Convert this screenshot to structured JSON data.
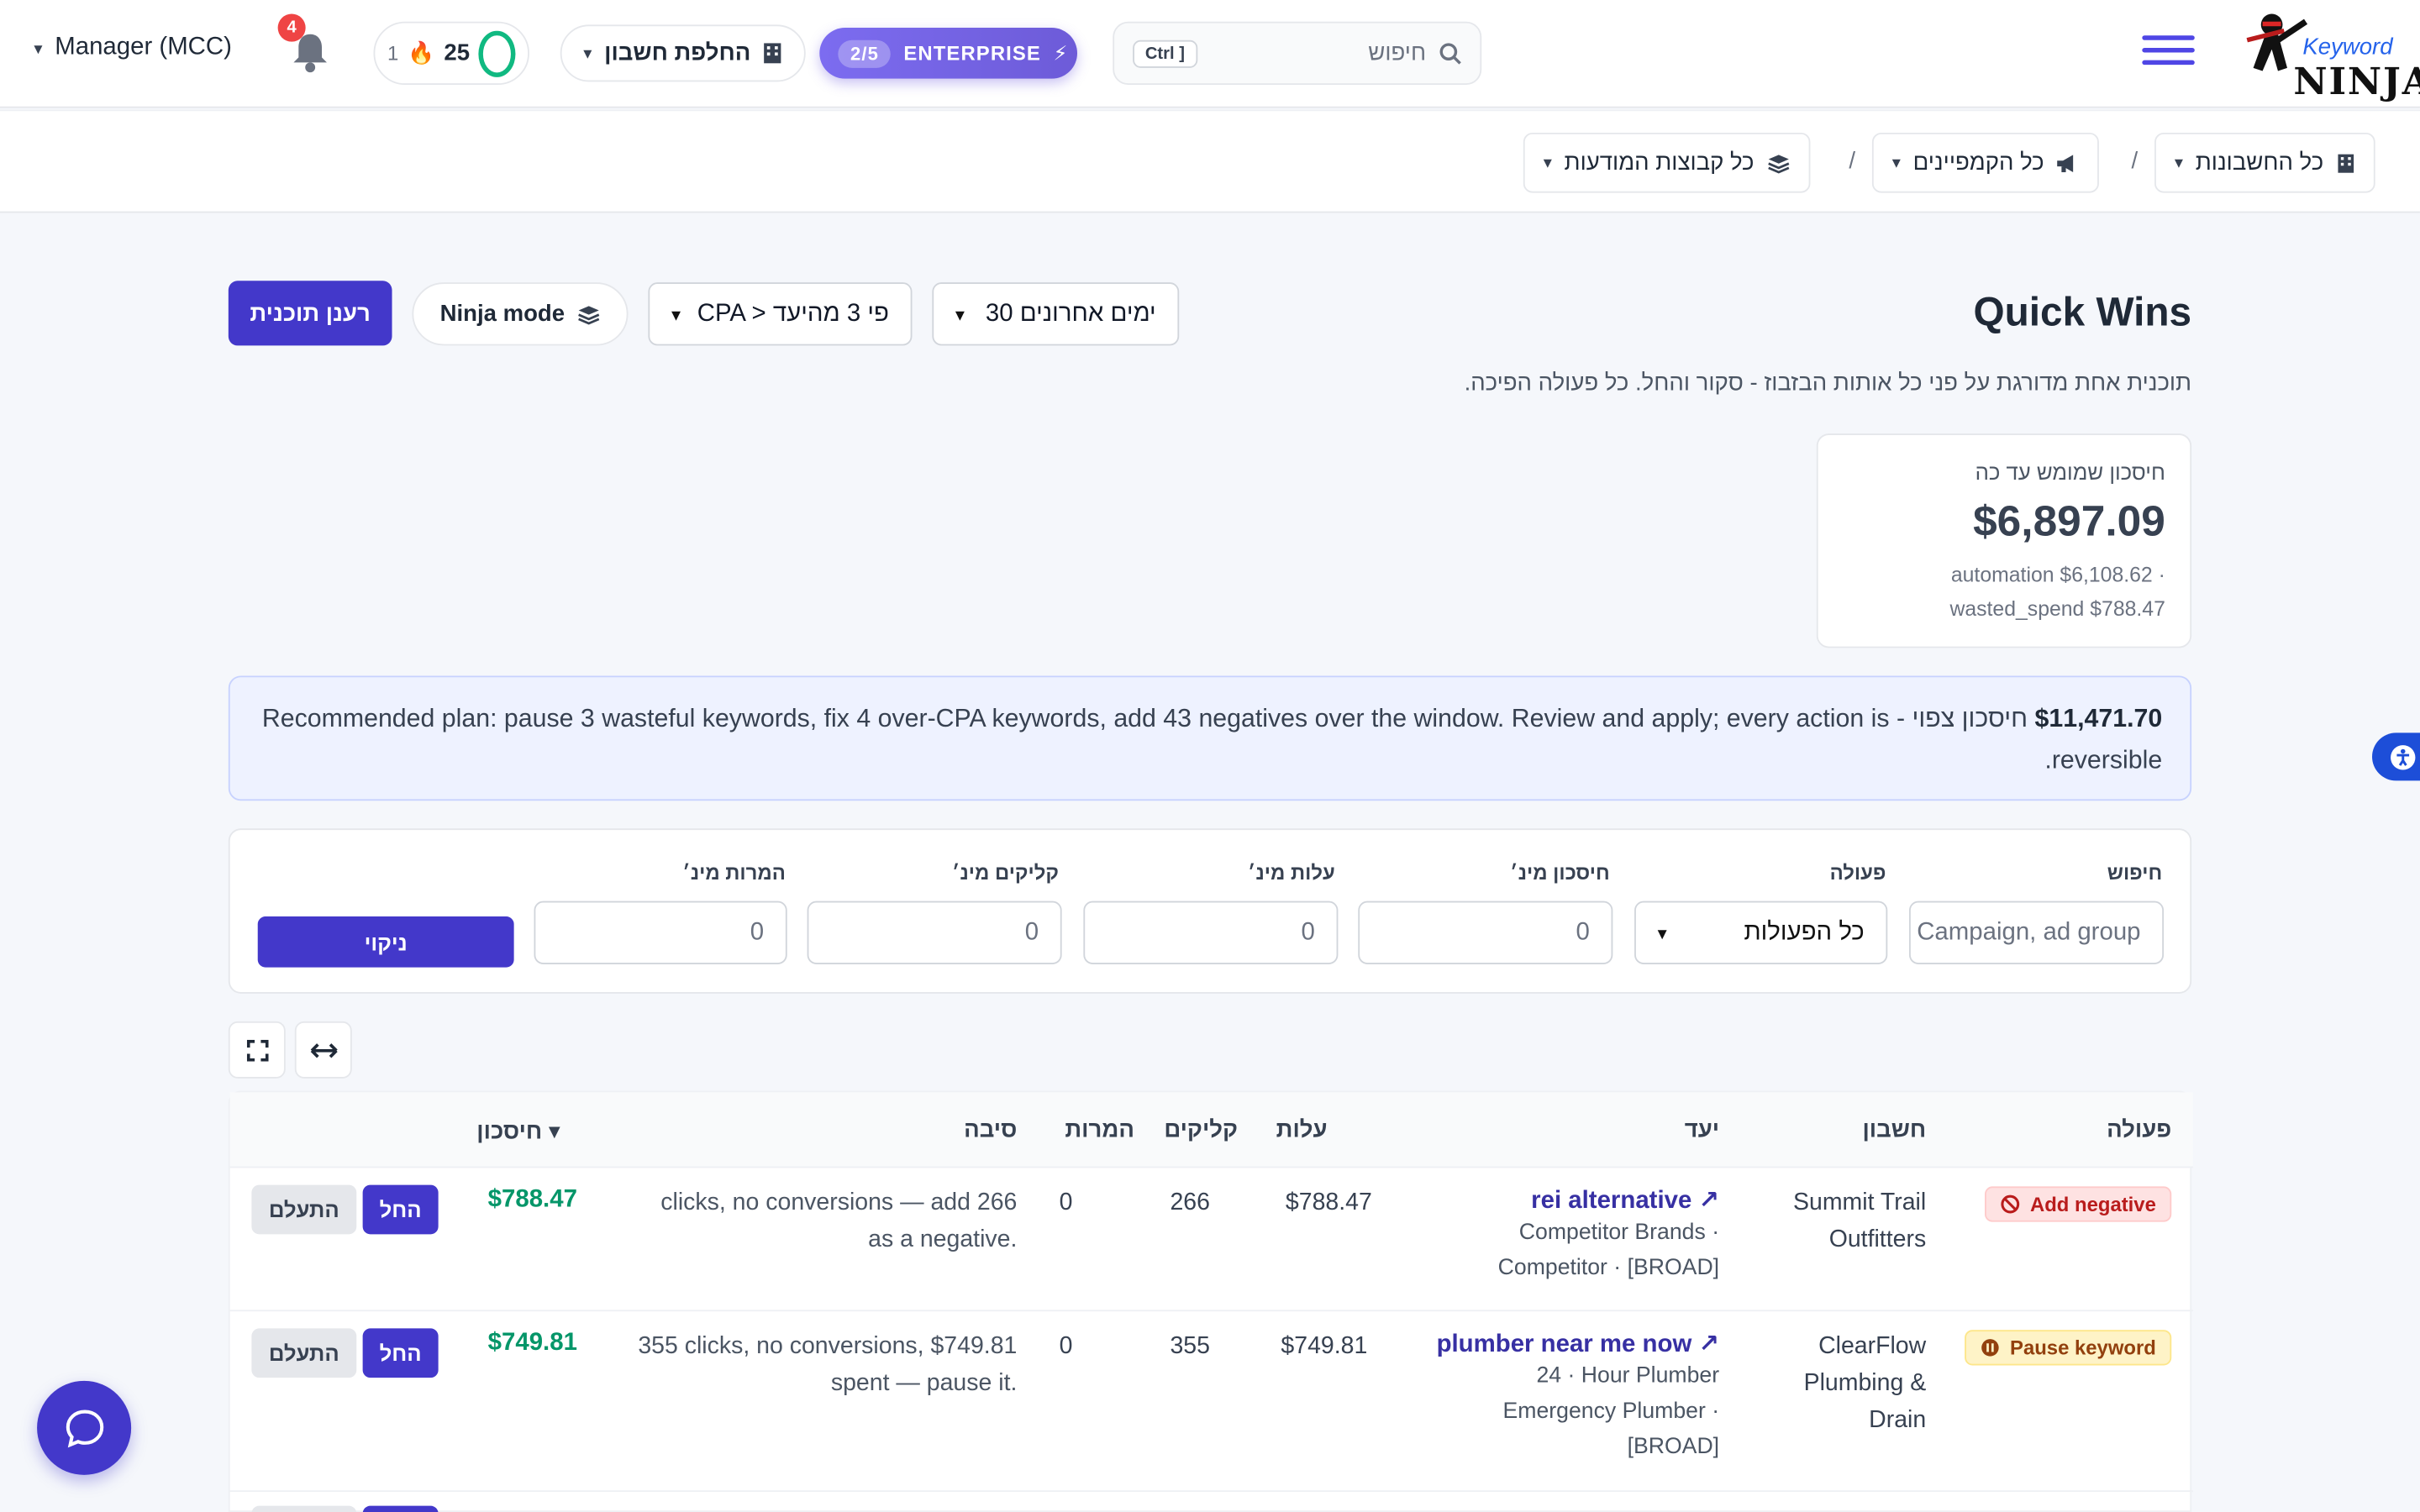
{
  "header": {
    "logo_word": "Keyword",
    "logo_brand": "NINJA",
    "search_placeholder": "חיפוש",
    "search_kbd": "Ctrl ]",
    "enterprise_label": "ENTERPRISE",
    "enterprise_frac": "2/5",
    "switch_account": "החלפת חשבון",
    "score_value": "25",
    "score_small": "1",
    "notifications_count": "4",
    "manager_label": "Manager (MCC)"
  },
  "breadcrumbs": {
    "accounts": "כל החשבונות",
    "campaigns": "כל הקמפיינים",
    "adgroups": "כל קבוצות המודעות",
    "sep": "/"
  },
  "page": {
    "title": "Quick Wins",
    "range_select": "30 ימים אחרונים",
    "cpa_select": "CPA > פי 3 מהיעד",
    "ninja_mode": "Ninja mode",
    "refresh_plan": "רענן תוכנית",
    "subtitle": "תוכנית אחת מדורגת על פני כל אותות הבזבוז - סקור והחל. כל פעולה הפיכה."
  },
  "savings": {
    "label": "חיסכון שמומש עד כה",
    "total": "$6,897.09",
    "automation": "automation $6,108.62 ·",
    "wasted": "wasted_spend $788.47"
  },
  "plan": {
    "amount": "$11,471.70",
    "amount_label": "חיסכון צפוי -",
    "text": "Recommended plan: pause 3 wasteful keywords, fix 4 over-CPA keywords, add 43 negatives over the window. Review and apply; every action is reversible."
  },
  "filters": {
    "search_label": "חיפוש",
    "search_placeholder": "Campaign, ad group",
    "action_label": "פעולה",
    "action_value": "כל הפעולות",
    "min_savings_label": "חיסכון מינ׳",
    "min_cost_label": "עלות מינ׳",
    "min_clicks_label": "קליקים מינ׳",
    "min_conv_label": "המרות מינ׳",
    "zero": "0",
    "clear": "ניקוי"
  },
  "table": {
    "headers": {
      "action": "פעולה",
      "account": "חשבון",
      "target": "יעד",
      "cost": "עלות",
      "clicks": "קליקים",
      "conversions": "המרות",
      "reason": "סיבה",
      "savings": "חיסכון ▾"
    },
    "apply_label": "החל",
    "ignore_label": "התעלם",
    "rows": [
      {
        "action": "Add negative",
        "account_line1": "Summit Trail",
        "account_line2": "Outfitters",
        "keyword": "rei alternative ↗",
        "target_line1": "Competitor Brands ·",
        "target_line2": "Competitor · [BROAD]",
        "target_line3": "",
        "cost": "$788.47",
        "clicks": "266",
        "conversions": "0",
        "reason_line1": "clicks, no conversions — add 266",
        "reason_line2": "as a negative.",
        "savings": "$788.47"
      },
      {
        "action": "Pause keyword",
        "account_line1": "ClearFlow",
        "account_line2": "Plumbing &",
        "account_line3": "Drain",
        "keyword": "plumber near me now ↗",
        "target_line1": "24 · Hour Plumber",
        "target_line2": "Emergency Plumber ·",
        "target_line3": "[BROAD]",
        "cost": "$749.81",
        "clicks": "355",
        "conversions": "0",
        "reason_line1": "355 clicks, no conversions, $749.81",
        "reason_line2": "spent — pause it.",
        "savings": "$749.81"
      }
    ]
  },
  "colors": {
    "primary": "#4338ca",
    "success": "#059669",
    "danger": "#ef4444",
    "warning": "#92400e"
  }
}
